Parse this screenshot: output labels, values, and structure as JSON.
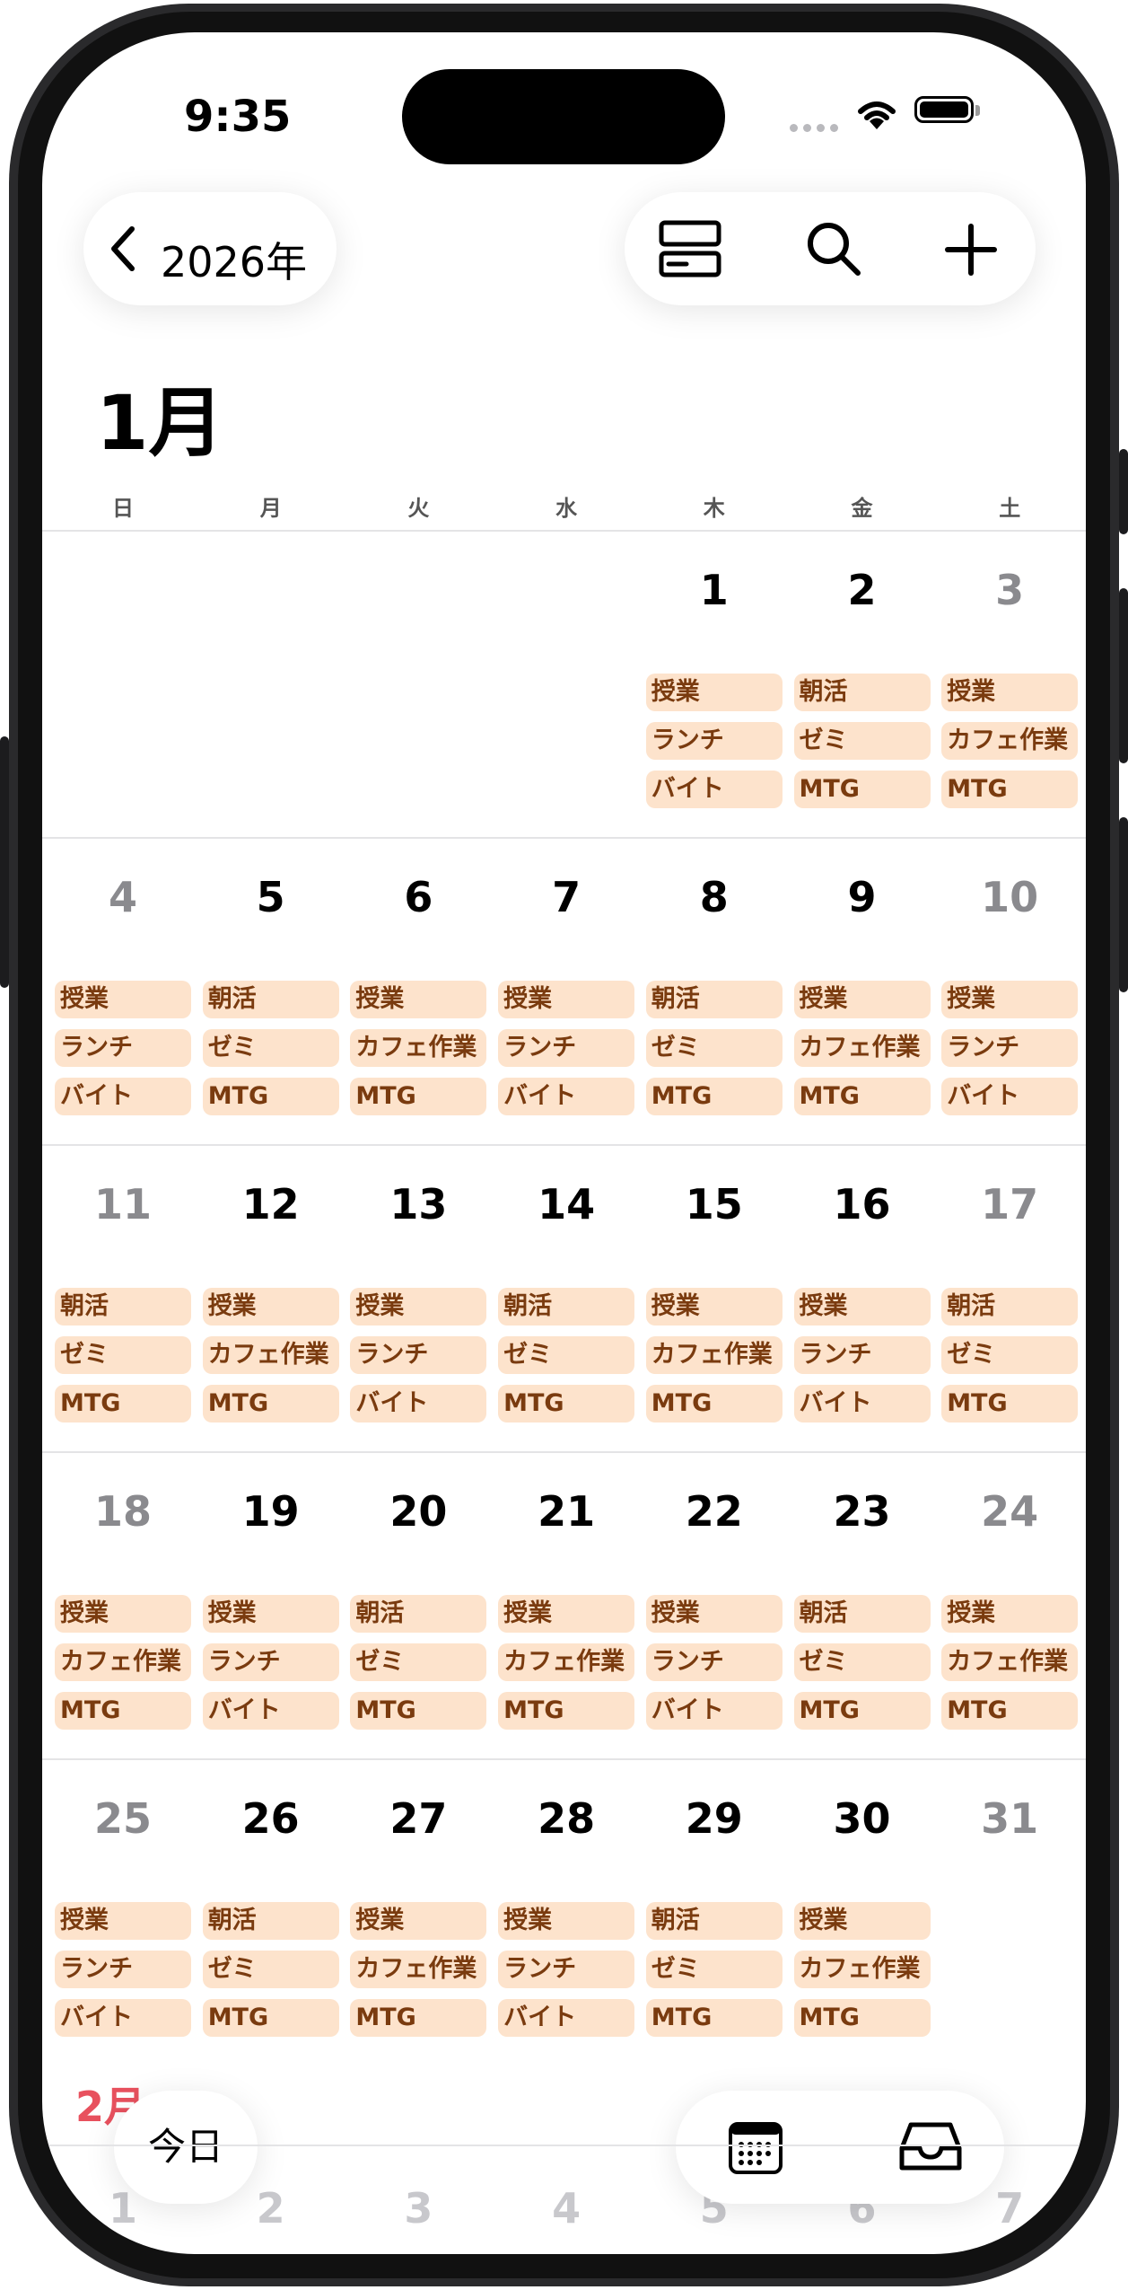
{
  "status_bar": {
    "time": "9:35"
  },
  "nav": {
    "back_label": "2026年"
  },
  "calendar": {
    "month": "1月",
    "weekdays": [
      "日",
      "月",
      "火",
      "水",
      "木",
      "金",
      "土"
    ],
    "weeks": [
      [
        {
          "day": "",
          "events": []
        },
        {
          "day": "",
          "events": []
        },
        {
          "day": "",
          "events": []
        },
        {
          "day": "",
          "events": []
        },
        {
          "day": "1",
          "events": [
            "授業",
            "ランチ",
            "バイト"
          ]
        },
        {
          "day": "2",
          "events": [
            "朝活",
            "ゼミ",
            "MTG"
          ]
        },
        {
          "day": "3",
          "events": [
            "授業",
            "カフェ作業",
            "MTG"
          ]
        }
      ],
      [
        {
          "day": "4",
          "events": [
            "授業",
            "ランチ",
            "バイト"
          ]
        },
        {
          "day": "5",
          "events": [
            "朝活",
            "ゼミ",
            "MTG"
          ]
        },
        {
          "day": "6",
          "events": [
            "授業",
            "カフェ作業",
            "MTG"
          ]
        },
        {
          "day": "7",
          "events": [
            "授業",
            "ランチ",
            "バイト"
          ]
        },
        {
          "day": "8",
          "events": [
            "朝活",
            "ゼミ",
            "MTG"
          ]
        },
        {
          "day": "9",
          "events": [
            "授業",
            "カフェ作業",
            "MTG"
          ]
        },
        {
          "day": "10",
          "events": [
            "授業",
            "ランチ",
            "バイト"
          ]
        }
      ],
      [
        {
          "day": "11",
          "events": [
            "朝活",
            "ゼミ",
            "MTG"
          ]
        },
        {
          "day": "12",
          "events": [
            "授業",
            "カフェ作業",
            "MTG"
          ]
        },
        {
          "day": "13",
          "events": [
            "授業",
            "ランチ",
            "バイト"
          ]
        },
        {
          "day": "14",
          "events": [
            "朝活",
            "ゼミ",
            "MTG"
          ]
        },
        {
          "day": "15",
          "events": [
            "授業",
            "カフェ作業",
            "MTG"
          ]
        },
        {
          "day": "16",
          "events": [
            "授業",
            "ランチ",
            "バイト"
          ]
        },
        {
          "day": "17",
          "events": [
            "朝活",
            "ゼミ",
            "MTG"
          ]
        }
      ],
      [
        {
          "day": "18",
          "events": [
            "授業",
            "カフェ作業",
            "MTG"
          ]
        },
        {
          "day": "19",
          "events": [
            "授業",
            "ランチ",
            "バイト"
          ]
        },
        {
          "day": "20",
          "events": [
            "朝活",
            "ゼミ",
            "MTG"
          ]
        },
        {
          "day": "21",
          "events": [
            "授業",
            "カフェ作業",
            "MTG"
          ]
        },
        {
          "day": "22",
          "events": [
            "授業",
            "ランチ",
            "バイト"
          ]
        },
        {
          "day": "23",
          "events": [
            "朝活",
            "ゼミ",
            "MTG"
          ]
        },
        {
          "day": "24",
          "events": [
            "授業",
            "カフェ作業",
            "MTG"
          ]
        }
      ],
      [
        {
          "day": "25",
          "events": [
            "授業",
            "ランチ",
            "バイト"
          ]
        },
        {
          "day": "26",
          "events": [
            "朝活",
            "ゼミ",
            "MTG"
          ]
        },
        {
          "day": "27",
          "events": [
            "授業",
            "カフェ作業",
            "MTG"
          ]
        },
        {
          "day": "28",
          "events": [
            "授業",
            "ランチ",
            "バイト"
          ]
        },
        {
          "day": "29",
          "events": [
            "朝活",
            "ゼミ",
            "MTG"
          ]
        },
        {
          "day": "30",
          "events": [
            "授業",
            "カフェ作業",
            "MTG"
          ]
        },
        {
          "day": "31",
          "events": []
        }
      ]
    ],
    "next_month": "2月",
    "next_month_days": [
      "1",
      "2",
      "3",
      "4",
      "5",
      "6",
      "7"
    ]
  },
  "bottom": {
    "today_label": "今日"
  },
  "icons": {
    "back": "chevron-left-icon",
    "view_toggle": "list-view-icon",
    "search": "search-icon",
    "add": "plus-icon",
    "calendars": "calendar-grid-icon",
    "inbox": "inbox-tray-icon"
  },
  "colors": {
    "event_bg": "#fde3cc",
    "event_text": "#7a3b0f",
    "weekend_day": "#8a8a8e",
    "next_month_label": "#e8515e"
  }
}
